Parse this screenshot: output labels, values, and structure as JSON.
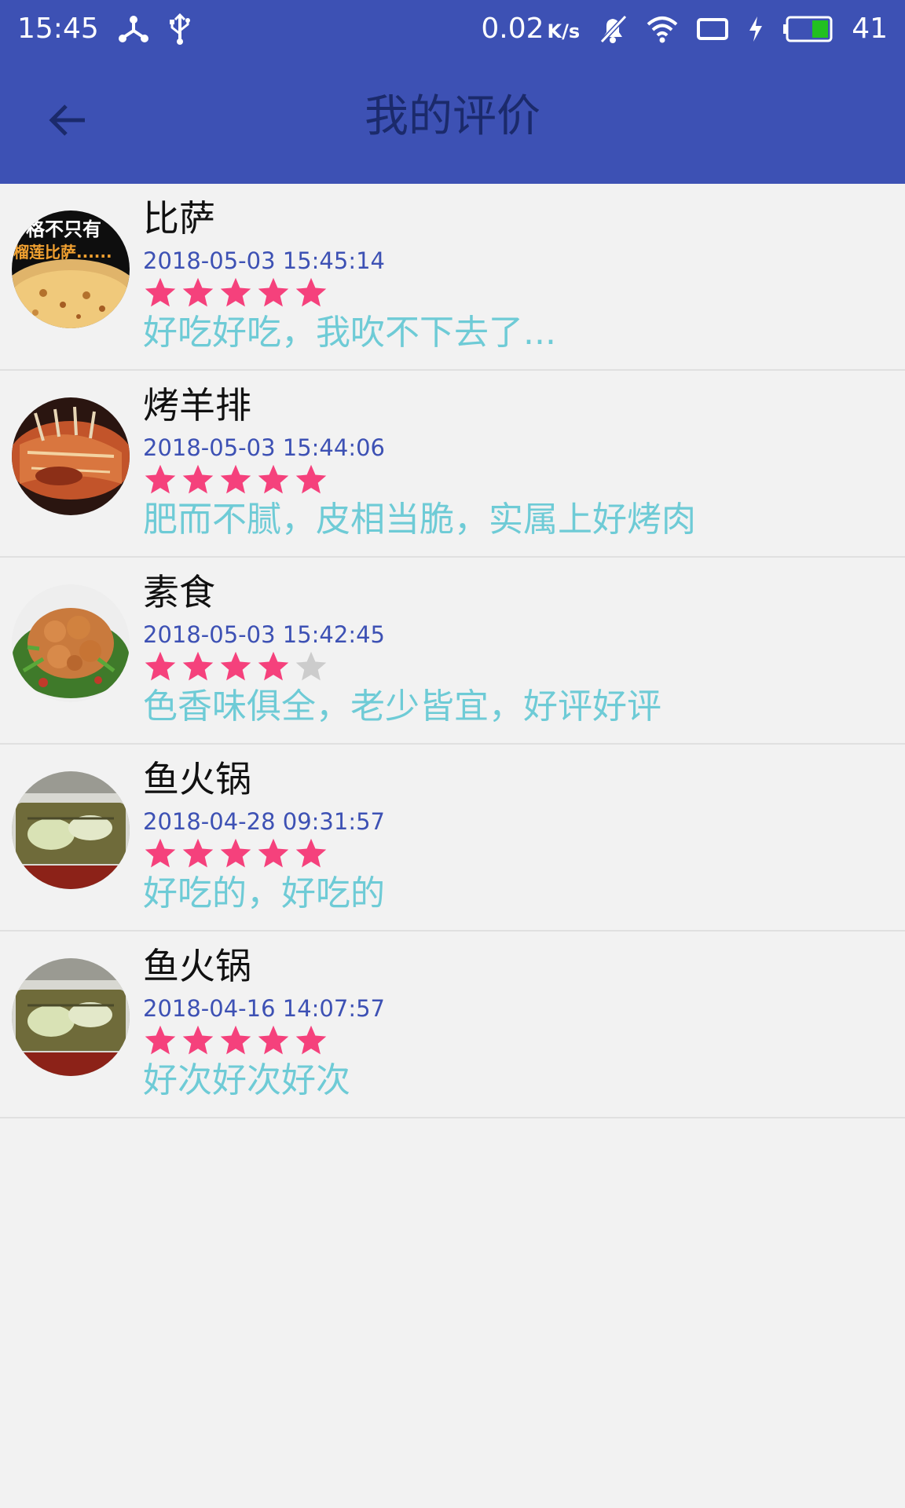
{
  "status_bar": {
    "time": "15:45",
    "net_speed": "0.02",
    "net_speed_unit": "K/s",
    "battery": "41",
    "icons": [
      "hotspot-icon",
      "usb-icon",
      "mute-bell-icon",
      "wifi-icon",
      "screen-icon",
      "charging-icon",
      "battery-icon"
    ]
  },
  "toolbar": {
    "back_icon": "arrow-left-icon",
    "title": "我的评价"
  },
  "colors": {
    "primary": "#3d51b4",
    "title_text": "#1b2a6b",
    "time_text": "#3d51b4",
    "comment_text": "#6ecbd6",
    "star_on": "#f5417c",
    "star_off": "#cccccc",
    "background": "#f2f2f2"
  },
  "reviews": [
    {
      "name": "比萨",
      "time": "2018-05-03  15:45:14",
      "rating": 5,
      "max_rating": 5,
      "comment": "好吃好吃，我吹不下去了...",
      "image_text": [
        "格不只有",
        "榴莲比萨......"
      ]
    },
    {
      "name": "烤羊排",
      "time": "2018-05-03  15:44:06",
      "rating": 5,
      "max_rating": 5,
      "comment": "肥而不腻，皮相当脆，实属上好烤肉"
    },
    {
      "name": "素食",
      "time": "2018-05-03  15:42:45",
      "rating": 4,
      "max_rating": 5,
      "comment": "色香味俱全，老少皆宜，好评好评"
    },
    {
      "name": "鱼火锅",
      "time": "2018-04-28 09:31:57",
      "rating": 5,
      "max_rating": 5,
      "comment": "好吃的，好吃的"
    },
    {
      "name": "鱼火锅",
      "time": "2018-04-16  14:07:57",
      "rating": 5,
      "max_rating": 5,
      "comment": "好次好次好次"
    }
  ]
}
